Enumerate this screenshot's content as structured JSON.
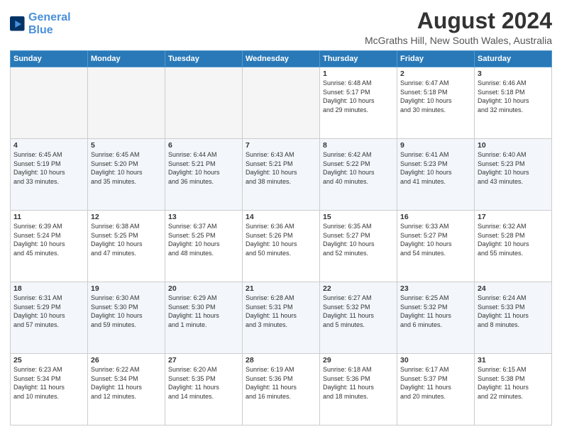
{
  "logo": {
    "line1": "General",
    "line2": "Blue",
    "icon": "▶"
  },
  "title": "August 2024",
  "location": "McGraths Hill, New South Wales, Australia",
  "headers": [
    "Sunday",
    "Monday",
    "Tuesday",
    "Wednesday",
    "Thursday",
    "Friday",
    "Saturday"
  ],
  "weeks": [
    [
      {
        "day": "",
        "info": ""
      },
      {
        "day": "",
        "info": ""
      },
      {
        "day": "",
        "info": ""
      },
      {
        "day": "",
        "info": ""
      },
      {
        "day": "1",
        "info": "Sunrise: 6:48 AM\nSunset: 5:17 PM\nDaylight: 10 hours\nand 29 minutes."
      },
      {
        "day": "2",
        "info": "Sunrise: 6:47 AM\nSunset: 5:18 PM\nDaylight: 10 hours\nand 30 minutes."
      },
      {
        "day": "3",
        "info": "Sunrise: 6:46 AM\nSunset: 5:18 PM\nDaylight: 10 hours\nand 32 minutes."
      }
    ],
    [
      {
        "day": "4",
        "info": "Sunrise: 6:45 AM\nSunset: 5:19 PM\nDaylight: 10 hours\nand 33 minutes."
      },
      {
        "day": "5",
        "info": "Sunrise: 6:45 AM\nSunset: 5:20 PM\nDaylight: 10 hours\nand 35 minutes."
      },
      {
        "day": "6",
        "info": "Sunrise: 6:44 AM\nSunset: 5:21 PM\nDaylight: 10 hours\nand 36 minutes."
      },
      {
        "day": "7",
        "info": "Sunrise: 6:43 AM\nSunset: 5:21 PM\nDaylight: 10 hours\nand 38 minutes."
      },
      {
        "day": "8",
        "info": "Sunrise: 6:42 AM\nSunset: 5:22 PM\nDaylight: 10 hours\nand 40 minutes."
      },
      {
        "day": "9",
        "info": "Sunrise: 6:41 AM\nSunset: 5:23 PM\nDaylight: 10 hours\nand 41 minutes."
      },
      {
        "day": "10",
        "info": "Sunrise: 6:40 AM\nSunset: 5:23 PM\nDaylight: 10 hours\nand 43 minutes."
      }
    ],
    [
      {
        "day": "11",
        "info": "Sunrise: 6:39 AM\nSunset: 5:24 PM\nDaylight: 10 hours\nand 45 minutes."
      },
      {
        "day": "12",
        "info": "Sunrise: 6:38 AM\nSunset: 5:25 PM\nDaylight: 10 hours\nand 47 minutes."
      },
      {
        "day": "13",
        "info": "Sunrise: 6:37 AM\nSunset: 5:25 PM\nDaylight: 10 hours\nand 48 minutes."
      },
      {
        "day": "14",
        "info": "Sunrise: 6:36 AM\nSunset: 5:26 PM\nDaylight: 10 hours\nand 50 minutes."
      },
      {
        "day": "15",
        "info": "Sunrise: 6:35 AM\nSunset: 5:27 PM\nDaylight: 10 hours\nand 52 minutes."
      },
      {
        "day": "16",
        "info": "Sunrise: 6:33 AM\nSunset: 5:27 PM\nDaylight: 10 hours\nand 54 minutes."
      },
      {
        "day": "17",
        "info": "Sunrise: 6:32 AM\nSunset: 5:28 PM\nDaylight: 10 hours\nand 55 minutes."
      }
    ],
    [
      {
        "day": "18",
        "info": "Sunrise: 6:31 AM\nSunset: 5:29 PM\nDaylight: 10 hours\nand 57 minutes."
      },
      {
        "day": "19",
        "info": "Sunrise: 6:30 AM\nSunset: 5:30 PM\nDaylight: 10 hours\nand 59 minutes."
      },
      {
        "day": "20",
        "info": "Sunrise: 6:29 AM\nSunset: 5:30 PM\nDaylight: 11 hours\nand 1 minute."
      },
      {
        "day": "21",
        "info": "Sunrise: 6:28 AM\nSunset: 5:31 PM\nDaylight: 11 hours\nand 3 minutes."
      },
      {
        "day": "22",
        "info": "Sunrise: 6:27 AM\nSunset: 5:32 PM\nDaylight: 11 hours\nand 5 minutes."
      },
      {
        "day": "23",
        "info": "Sunrise: 6:25 AM\nSunset: 5:32 PM\nDaylight: 11 hours\nand 6 minutes."
      },
      {
        "day": "24",
        "info": "Sunrise: 6:24 AM\nSunset: 5:33 PM\nDaylight: 11 hours\nand 8 minutes."
      }
    ],
    [
      {
        "day": "25",
        "info": "Sunrise: 6:23 AM\nSunset: 5:34 PM\nDaylight: 11 hours\nand 10 minutes."
      },
      {
        "day": "26",
        "info": "Sunrise: 6:22 AM\nSunset: 5:34 PM\nDaylight: 11 hours\nand 12 minutes."
      },
      {
        "day": "27",
        "info": "Sunrise: 6:20 AM\nSunset: 5:35 PM\nDaylight: 11 hours\nand 14 minutes."
      },
      {
        "day": "28",
        "info": "Sunrise: 6:19 AM\nSunset: 5:36 PM\nDaylight: 11 hours\nand 16 minutes."
      },
      {
        "day": "29",
        "info": "Sunrise: 6:18 AM\nSunset: 5:36 PM\nDaylight: 11 hours\nand 18 minutes."
      },
      {
        "day": "30",
        "info": "Sunrise: 6:17 AM\nSunset: 5:37 PM\nDaylight: 11 hours\nand 20 minutes."
      },
      {
        "day": "31",
        "info": "Sunrise: 6:15 AM\nSunset: 5:38 PM\nDaylight: 11 hours\nand 22 minutes."
      }
    ]
  ]
}
